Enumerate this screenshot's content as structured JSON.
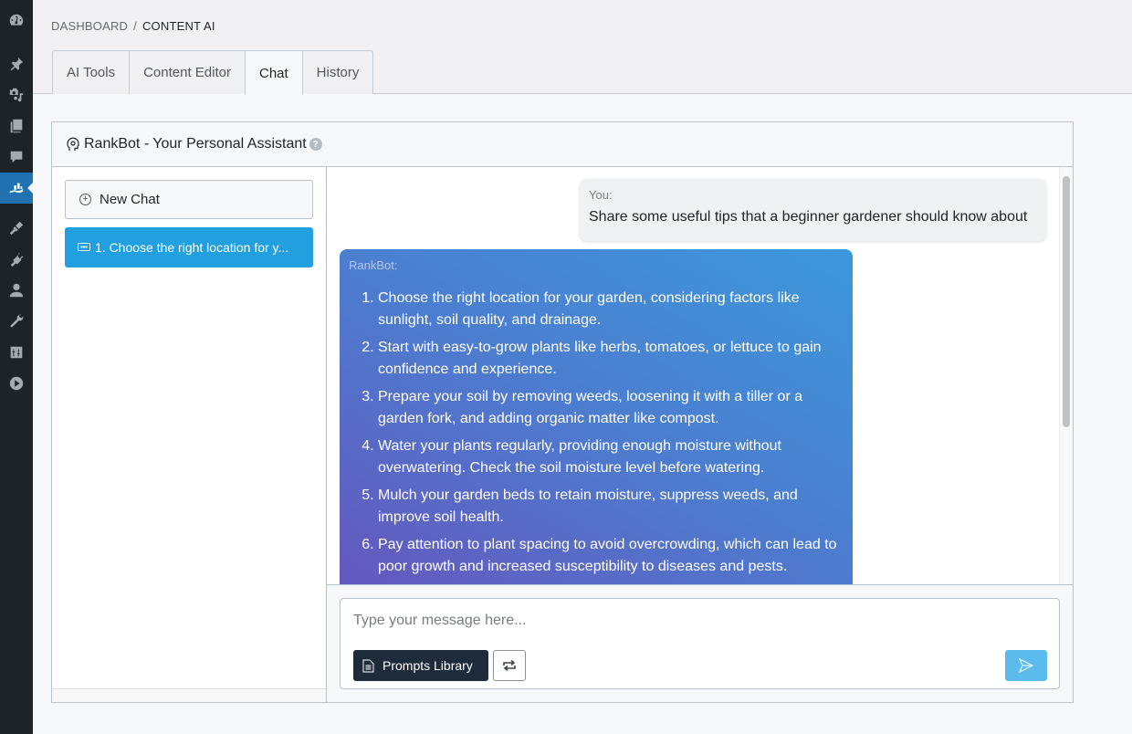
{
  "admin_menu": {
    "items": [
      {
        "icon": "dashboard-icon"
      },
      {
        "icon": "pin-icon"
      },
      {
        "icon": "media-icon"
      },
      {
        "icon": "pages-icon"
      },
      {
        "icon": "comments-icon"
      },
      {
        "icon": "rank-math-icon",
        "active": true
      },
      {
        "icon": "appearance-icon"
      },
      {
        "icon": "plugins-icon"
      },
      {
        "icon": "users-icon"
      },
      {
        "icon": "tools-icon"
      },
      {
        "icon": "settings-icon"
      },
      {
        "icon": "play-icon"
      }
    ]
  },
  "breadcrumb": {
    "parent": "DASHBOARD",
    "separator": "/",
    "current": "CONTENT AI"
  },
  "tabs": [
    {
      "label": "AI Tools",
      "active": false
    },
    {
      "label": "Content Editor",
      "active": false
    },
    {
      "label": "Chat",
      "active": true
    },
    {
      "label": "History",
      "active": false
    }
  ],
  "panel": {
    "title": "RankBot - Your Personal Assistant",
    "help": "?"
  },
  "sidebar": {
    "new_chat_label": "New Chat",
    "history": [
      {
        "label": "1. Choose the right location for y...",
        "active": true
      }
    ]
  },
  "conversation": {
    "user": {
      "author": "You:",
      "text": "Share some useful tips that a beginner gardener should know about"
    },
    "bot": {
      "author": "RankBot:",
      "items": [
        "Choose the right location for your garden, considering factors like sunlight, soil quality, and drainage.",
        "Start with easy-to-grow plants like herbs, tomatoes, or lettuce to gain confidence and experience.",
        "Prepare your soil by removing weeds, loosening it with a tiller or a garden fork, and adding organic matter like compost.",
        "Water your plants regularly, providing enough moisture without overwatering. Check the soil moisture level before watering.",
        "Mulch your garden beds to retain moisture, suppress weeds, and improve soil health.",
        "Pay attention to plant spacing to avoid overcrowding, which can lead to poor growth and increased susceptibility to diseases and pests."
      ]
    }
  },
  "composer": {
    "placeholder": "Type your message here...",
    "value": "",
    "prompts_label": "Prompts Library"
  },
  "colors": {
    "admin_bg": "#1d2327",
    "admin_active": "#2271b1",
    "history_active": "#229fdf",
    "prompts_btn": "#1e2b3a",
    "send_btn": "#5bbbec",
    "bot_gradient_start": "#6656bd",
    "bot_gradient_end": "#3c98db"
  }
}
